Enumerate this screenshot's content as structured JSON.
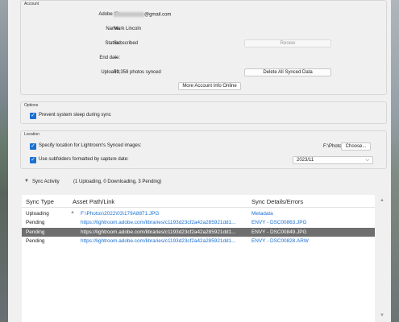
{
  "account": {
    "section_title": "Account",
    "adobe_id_label": "Adobe ID:",
    "adobe_id_suffix": "@gmail.com",
    "name_label": "Name:",
    "name_value": "Mark Lincoln",
    "status_label": "Status:",
    "status_value": "Subscribed",
    "renew_button": "Renew",
    "end_date_label": "End date:",
    "end_date_value": "---",
    "uploads_label": "Uploads:",
    "uploads_value": "59,358 photos synced",
    "delete_button": "Delete All Synced Data",
    "more_info_button": "More Account Info Online"
  },
  "options": {
    "section_title": "Options",
    "prevent_sleep_label": "Prevent system sleep during sync"
  },
  "location": {
    "section_title": "Location",
    "specify_label": "Specify location for Lightroom's Synced images:",
    "path_value": "F:\\Photos",
    "choose_button": "Choose...",
    "subfolders_label": "Use subfolders formatted by capture date:",
    "date_format_value": "2023/11"
  },
  "sync_activity": {
    "toggle_label": "Sync Activity",
    "summary": "(1 Uploading, 0 Downloading, 3 Pending)"
  },
  "table": {
    "headers": {
      "sync_type": "Sync Type",
      "asset": "Asset Path/Link",
      "details": "Sync Details/Errors"
    },
    "rows": [
      {
        "type": "Uploading",
        "asset": "F:\\Photos\\2022\\03\\179A8871.JPG",
        "details": "Metadata"
      },
      {
        "type": "Pending",
        "asset": "https://lightroom.adobe.com/libraries/c1193d23cf2a42a285921dd1...",
        "details": "ENVY - DSC00863.JPG"
      },
      {
        "type": "Pending",
        "asset": "https://lightroom.adobe.com/libraries/c1193d23cf2a42a285921dd1...",
        "details": "ENVY - DSC00849.JPG"
      },
      {
        "type": "Pending",
        "asset": "https://lightroom.adobe.com/libraries/c1193d23cf2a42a285921dd1...",
        "details": "ENVY - DSC00828.ARW"
      }
    ]
  },
  "colors": {
    "link": "#1a6fd1",
    "checkbox": "#1a6fd1",
    "selected_row": "#6e6e6e"
  }
}
